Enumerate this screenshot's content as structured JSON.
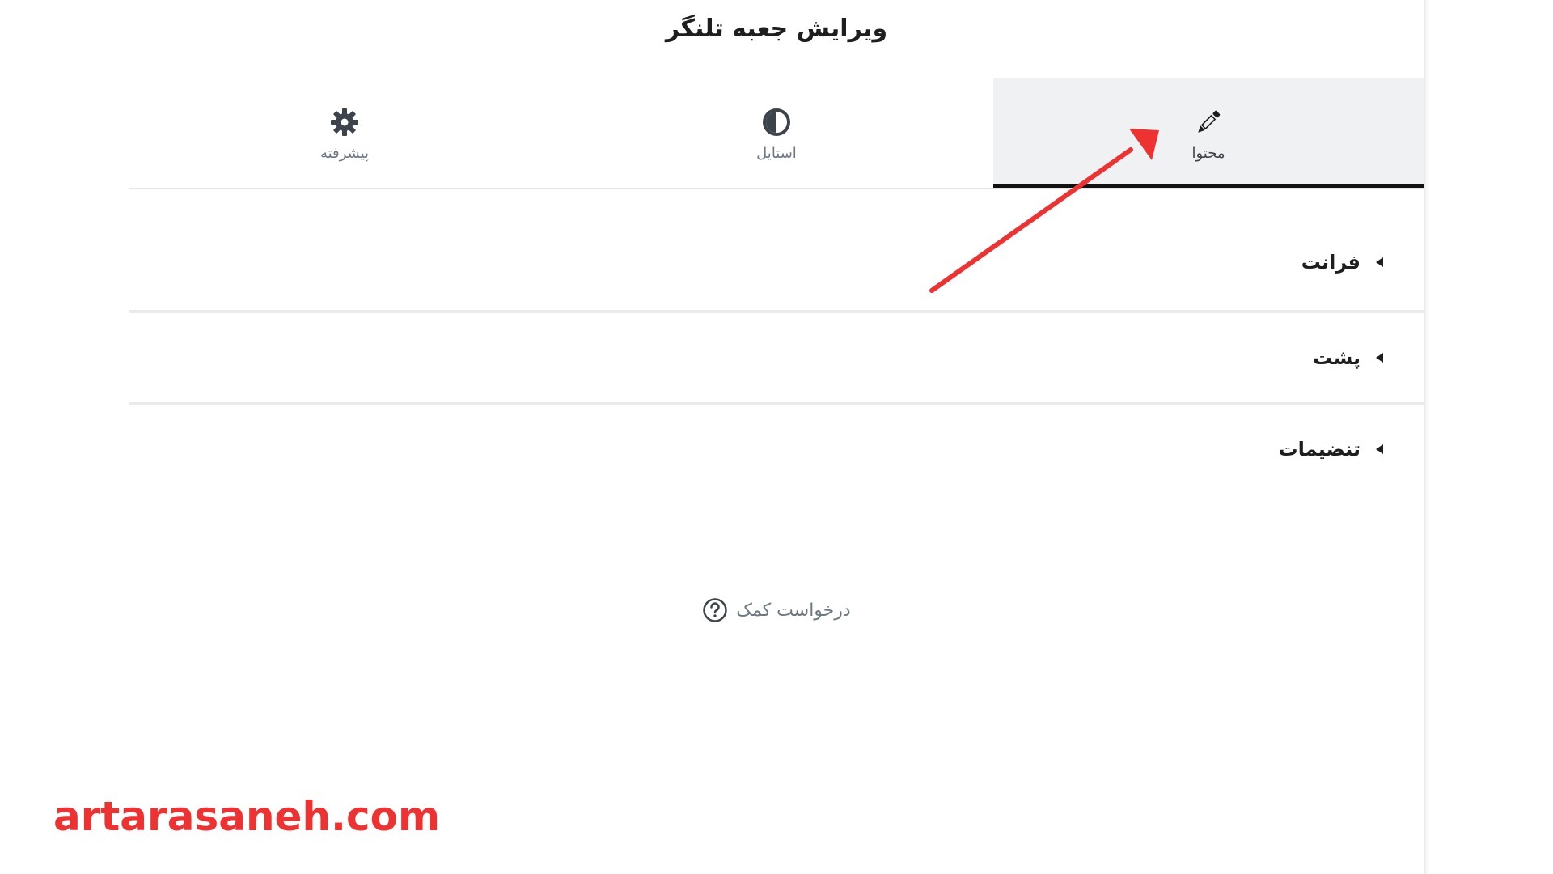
{
  "editor": {
    "title": "ویرایش جعبه تلنگر"
  },
  "tabs": [
    {
      "label": "پیشرفته",
      "icon": "gear-icon",
      "active": false
    },
    {
      "label": "استایل",
      "icon": "contrast-icon",
      "active": false
    },
    {
      "label": "محتوا",
      "icon": "pencil-icon",
      "active": true
    }
  ],
  "sections": [
    {
      "title": "فرانت",
      "icon": "caret-left-icon"
    },
    {
      "title": "پشت",
      "icon": "caret-left-icon"
    },
    {
      "title": "تنضیمات",
      "icon": "caret-left-icon"
    }
  ],
  "help": {
    "label": "درخواست کمک",
    "icon": "question-circle-icon"
  },
  "annotation": {
    "color": "#ee3232",
    "points_to": "tab-content"
  },
  "watermark": {
    "text": "artarasaneh.com",
    "color": "#ee3232"
  },
  "colors": {
    "active_tab_bg": "#f0f1f3",
    "active_tab_indicator": "#111111",
    "muted_text": "#6d7882",
    "icon_dark": "#3d434a"
  }
}
